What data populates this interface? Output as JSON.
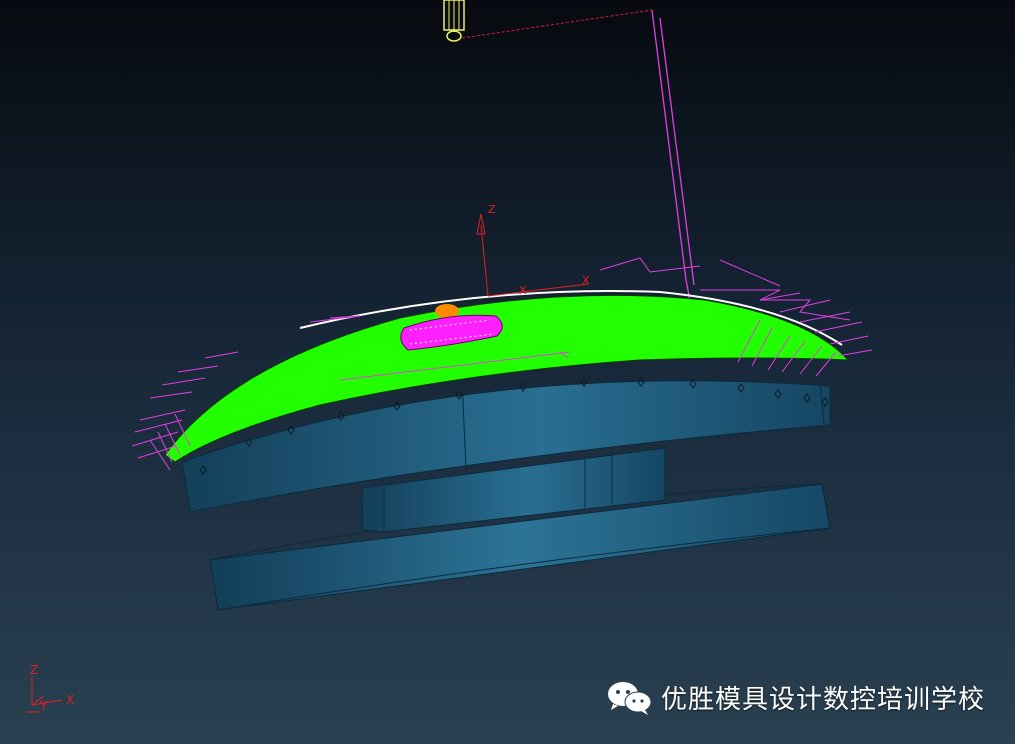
{
  "viewport": {
    "background_top": "#070a0f",
    "background_bottom": "#2a4152"
  },
  "colors": {
    "part_body": "#1d5677",
    "part_edge": "#0b2a3d",
    "machined_surface": "#22ff00",
    "toolpath": "#e040e0",
    "rapid_move": "#d02030",
    "tool": "#f0f060",
    "axis": "#e02020",
    "feature_magenta": "#ff20ff",
    "feature_orange": "#ff8a00"
  },
  "workplane_axes": {
    "z_label": "Z",
    "x_label": "X"
  },
  "view_triad": {
    "z_label": "Z",
    "y_label": "Y",
    "x_label": "X"
  },
  "watermark": {
    "icon": "wechat-icon",
    "text": "优胜模具设计数控培训学校"
  }
}
